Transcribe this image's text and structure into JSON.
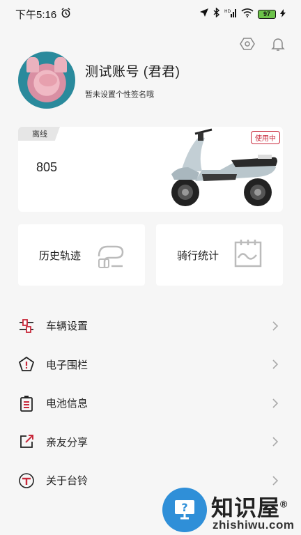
{
  "status_bar": {
    "time": "下午5:16",
    "battery": "97"
  },
  "profile": {
    "username": "测试账号 (君君)",
    "signature": "暂未设置个性签名哦"
  },
  "vehicle": {
    "status_tag": "离线",
    "name": "805",
    "in_use_badge": "使用中"
  },
  "functions": [
    {
      "label": "历史轨迹",
      "icon": "track-illustration"
    },
    {
      "label": "骑行统计",
      "icon": "stats-illustration"
    }
  ],
  "menu": [
    {
      "label": "车辆设置",
      "icon": "sliders-icon"
    },
    {
      "label": "电子围栏",
      "icon": "pentagon-fence-icon"
    },
    {
      "label": "电池信息",
      "icon": "battery-icon"
    },
    {
      "label": "亲友分享",
      "icon": "share-icon"
    },
    {
      "label": "关于台铃",
      "icon": "tailg-logo-icon"
    }
  ],
  "watermark": {
    "title": "知识屋",
    "url": "zhishiwu.com",
    "registered": "®"
  },
  "colors": {
    "accent": "#c8283a",
    "background": "#f6f6f6",
    "card": "#ffffff",
    "watermark_blue": "#2f8fd8"
  }
}
